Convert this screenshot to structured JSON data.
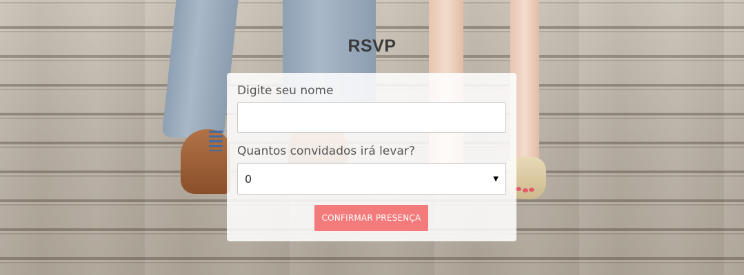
{
  "page": {
    "title": "RSVP"
  },
  "form": {
    "name_label": "Digite seu nome",
    "name_value": "",
    "guests_label": "Quantos convidados irá levar?",
    "guests_selected": "0",
    "submit_label": "CONFIRMAR PRESENÇA"
  },
  "colors": {
    "button": "#f47b7b",
    "title": "#3a3a3a",
    "label": "#555555"
  },
  "icons": {
    "select_caret": "chevron-down-icon"
  }
}
